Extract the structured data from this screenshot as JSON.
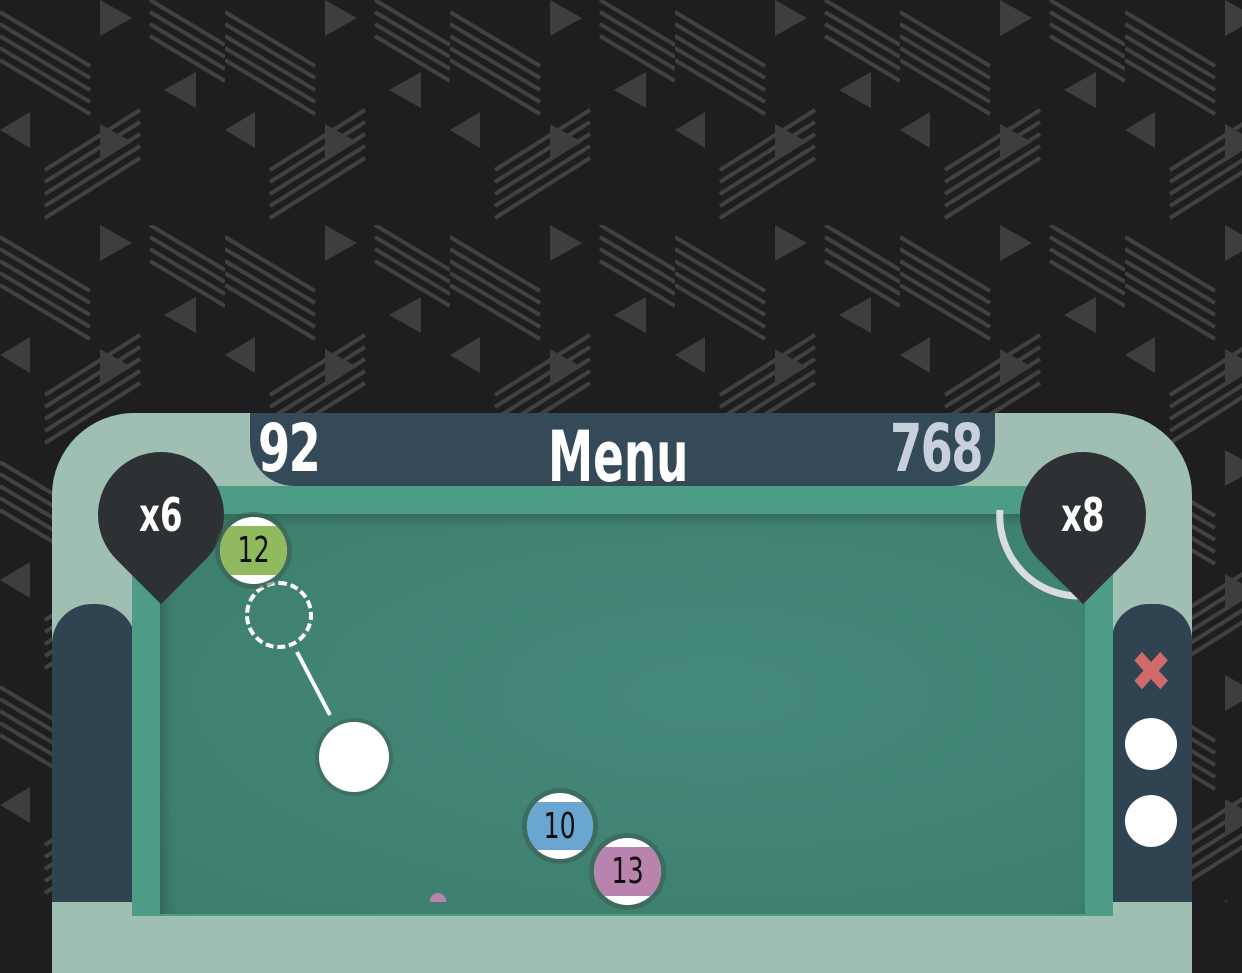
{
  "header": {
    "score_left": "92",
    "menu_label": "Menu",
    "score_right": "768"
  },
  "pockets": {
    "left_multiplier": "x6",
    "right_multiplier": "x8"
  },
  "balls": [
    {
      "number": "12",
      "color": "#8fba5e",
      "type": "stripe"
    },
    {
      "number": "10",
      "color": "#6aa6cf",
      "type": "stripe"
    },
    {
      "number": "13",
      "color": "#b883ac",
      "type": "stripe"
    }
  ],
  "colors": {
    "felt": "#3f8170",
    "cushion": "#4c9c86",
    "frame": "#9fbfb2",
    "header": "#344a58",
    "close_icon": "#d06a6a"
  },
  "side_panel": {
    "close_icon": "close-icon",
    "remaining_shots": 2
  }
}
